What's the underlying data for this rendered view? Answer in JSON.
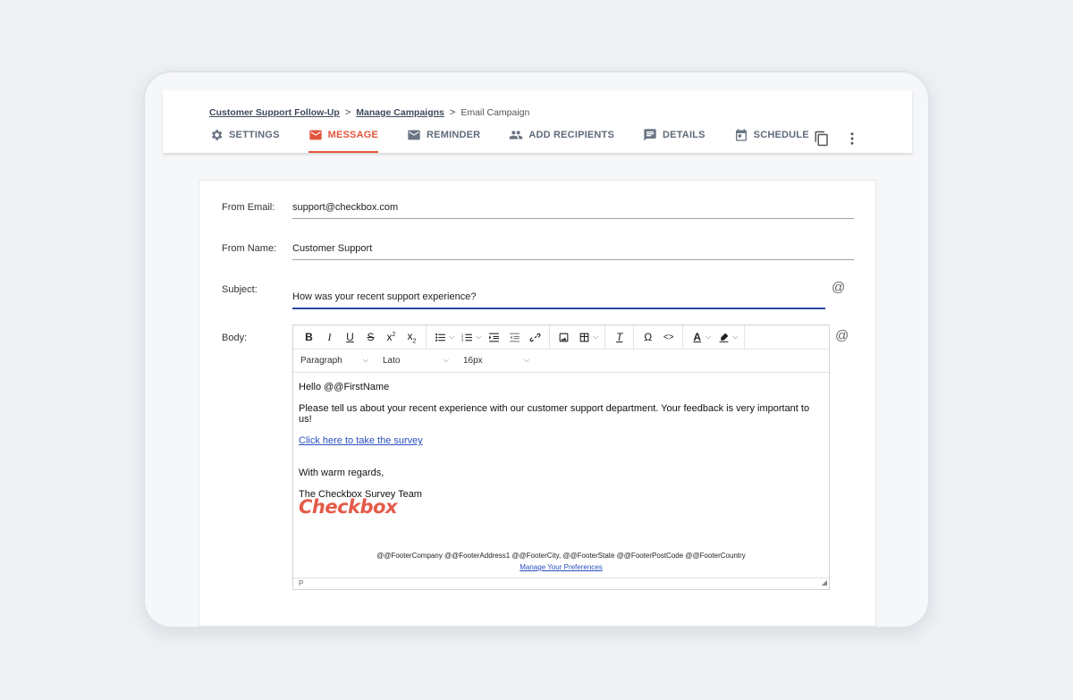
{
  "breadcrumb": {
    "item1": "Customer Support Follow-Up",
    "item2": "Manage Campaigns",
    "current": "Email Campaign",
    "sep": ">"
  },
  "tabs": [
    {
      "label": "SETTINGS",
      "icon": "gear-icon"
    },
    {
      "label": "MESSAGE",
      "icon": "envelope-icon",
      "active": true
    },
    {
      "label": "REMINDER",
      "icon": "envelope-icon"
    },
    {
      "label": "ADD RECIPIENTS",
      "icon": "people-icon"
    },
    {
      "label": "DETAILS",
      "icon": "details-icon"
    },
    {
      "label": "SCHEDULE",
      "icon": "calendar-icon"
    }
  ],
  "form": {
    "from_email_label": "From Email:",
    "from_email_value": "support@checkbox.com",
    "from_name_label": "From Name:",
    "from_name_value": "Customer Support",
    "subject_label": "Subject:",
    "subject_value": "How was your recent support experience?",
    "body_label": "Body:",
    "at_symbol": "@"
  },
  "editor": {
    "format_select": "Paragraph",
    "font_select": "Lato",
    "size_select": "16px",
    "greeting": "Hello @@FirstName",
    "paragraph": "Please tell us about your recent experience with our customer support department. Your feedback is very important to us!",
    "survey_link": "Click here to take the survey",
    "closing": "With warm regards,",
    "signature": "The Checkbox Survey Team",
    "logo_text": "Checkbox",
    "footer_address": "@@FooterCompany @@FooterAddress1 @@FooterCity, @@FooterState @@FooterPostCode @@FooterCountry",
    "preferences_link": "Manage Your Preferences",
    "status_path": "P"
  },
  "colors": {
    "accent": "#e2553d",
    "link": "#2a4fc0",
    "focus": "#2d4ba0"
  }
}
